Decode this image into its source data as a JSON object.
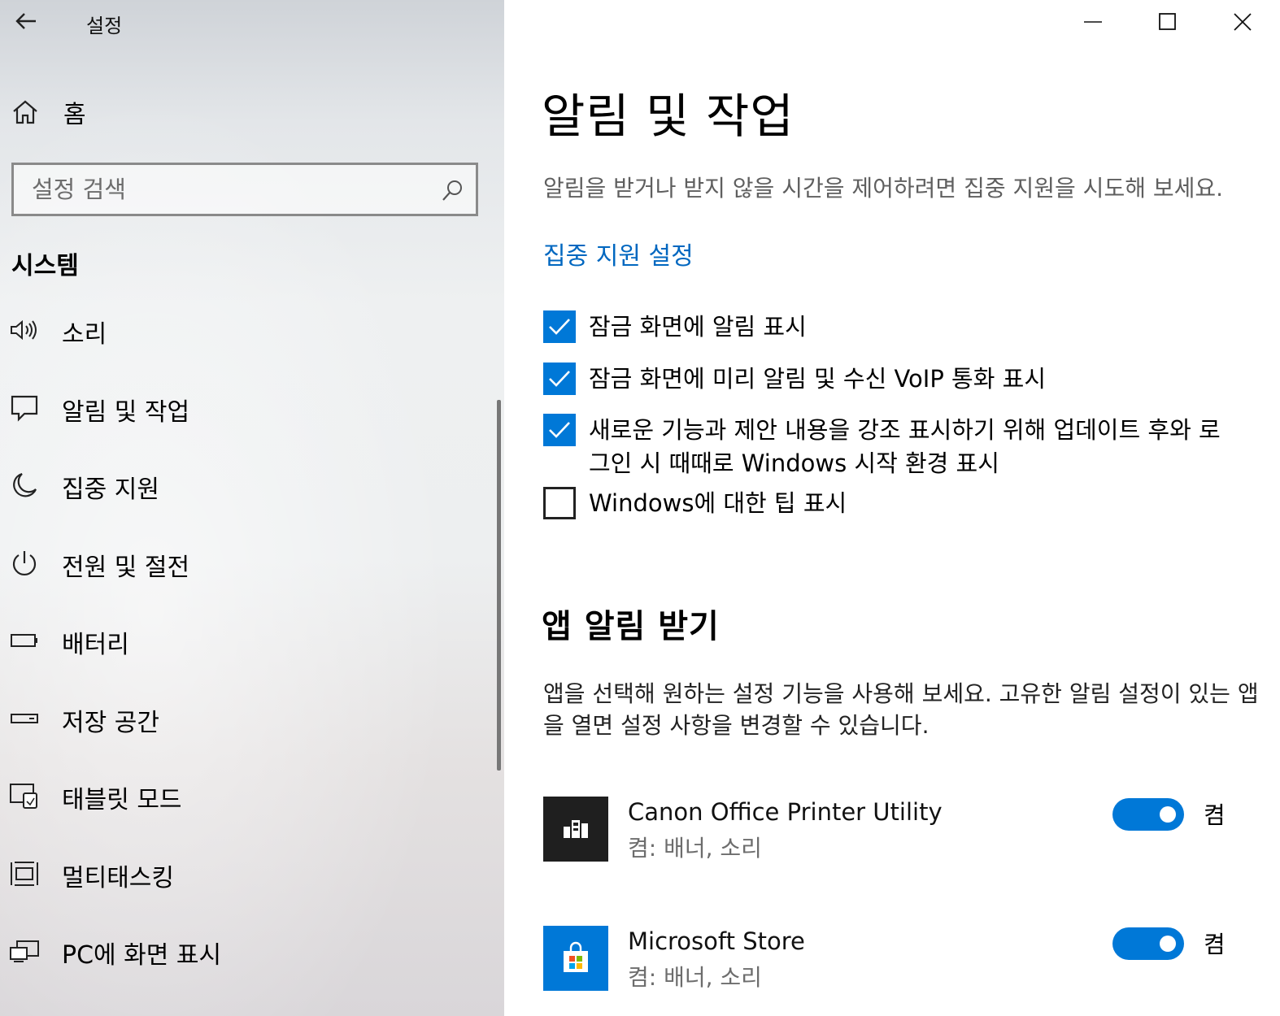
{
  "window": {
    "title": "설정"
  },
  "sidebar": {
    "home_label": "홈",
    "search_placeholder": "설정 검색",
    "section_heading": "시스템",
    "items": [
      {
        "label": "소리",
        "icon": "speaker-icon"
      },
      {
        "label": "알림 및 작업",
        "icon": "notification-icon"
      },
      {
        "label": "집중 지원",
        "icon": "moon-icon"
      },
      {
        "label": "전원 및 절전",
        "icon": "power-icon"
      },
      {
        "label": "배터리",
        "icon": "battery-icon"
      },
      {
        "label": "저장 공간",
        "icon": "storage-icon"
      },
      {
        "label": "태블릿 모드",
        "icon": "tablet-mode-icon"
      },
      {
        "label": "멀티태스킹",
        "icon": "multitasking-icon"
      },
      {
        "label": "PC에 화면 표시",
        "icon": "project-icon"
      }
    ]
  },
  "main": {
    "title": "알림 및 작업",
    "description": "알림을 받거나 받지 않을 시간을 제어하려면 집중 지원을 시도해 보세요.",
    "focus_link": "집중 지원 설정",
    "checkboxes": [
      {
        "label": "잠금 화면에 알림 표시",
        "checked": true
      },
      {
        "label": "잠금 화면에 미리 알림 및 수신 VoIP 통화 표시",
        "checked": true
      },
      {
        "label": "새로운 기능과 제안 내용을 강조 표시하기 위해 업데이트 후와 로그인 시 때때로 Windows 시작 환경 표시",
        "checked": true
      },
      {
        "label": "Windows에 대한 팁 표시",
        "checked": false
      }
    ],
    "apps_section_title": "앱 알림 받기",
    "apps_description": "앱을 선택해 원하는 설정 기능을 사용해 보세요. 고유한 알림 설정이 있는 앱을 열면 설정 사항을 변경할 수 있습니다.",
    "apps": [
      {
        "name": "Canon Office Printer Utility",
        "detail": "켬: 배너, 소리",
        "state": "켬",
        "tile_color": "#1f1f1f"
      },
      {
        "name": "Microsoft Store",
        "detail": "켬: 배너, 소리",
        "state": "켬",
        "tile_color": "#0078d7"
      }
    ]
  },
  "colors": {
    "accent": "#0078d7",
    "link": "#0067c0"
  }
}
